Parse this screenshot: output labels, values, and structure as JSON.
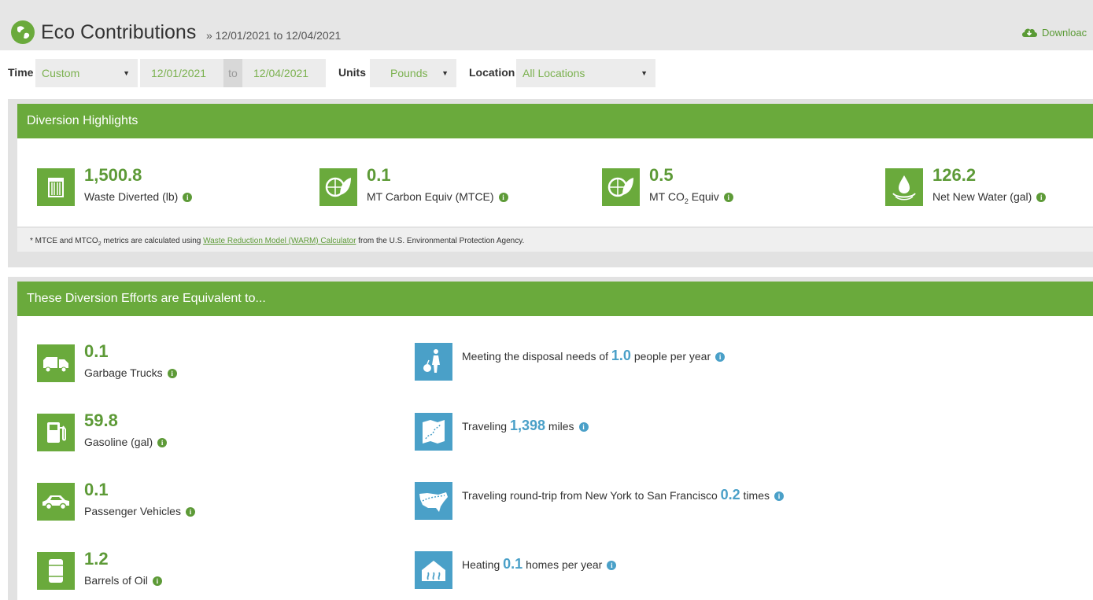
{
  "header": {
    "title": "Eco Contributions",
    "subtitle": "» 12/01/2021 to 12/04/2021",
    "download_label": "Downloac"
  },
  "filters": {
    "time_label": "Time",
    "time_value": "Custom",
    "start_date": "12/01/2021",
    "to_label": "to",
    "end_date": "12/04/2021",
    "units_label": "Units",
    "units_value": "Pounds",
    "location_label": "Location",
    "location_value": "All Locations"
  },
  "highlights": {
    "heading": "Diversion Highlights",
    "metrics": [
      {
        "value": "1,500.8",
        "label": "Waste Diverted (lb)",
        "icon": "trash-can-icon"
      },
      {
        "value": "0.1",
        "label": "MT Carbon Equiv (MTCE)",
        "icon": "leaf-globe-icon"
      },
      {
        "value": "0.5",
        "label_pre": "MT CO",
        "label_sub": "2",
        "label_post": " Equiv",
        "icon": "leaf-globe-icon"
      },
      {
        "value": "126.2",
        "label": "Net New Water (gal)",
        "icon": "water-drop-icon"
      }
    ],
    "footnote_pre": "* MTCE and MTCO",
    "footnote_sub": "2",
    "footnote_mid": " metrics are calculated using ",
    "footnote_link": "Waste Reduction Model (WARM) Calculator",
    "footnote_post": " from the U.S. Environmental Protection Agency."
  },
  "equivalents": {
    "heading": "These Diversion Efforts are Equivalent to...",
    "left": [
      {
        "value": "0.1",
        "label": "Garbage Trucks",
        "icon": "garbage-truck-icon"
      },
      {
        "value": "59.8",
        "label": "Gasoline (gal)",
        "icon": "gas-pump-icon"
      },
      {
        "value": "0.1",
        "label": "Passenger Vehicles",
        "icon": "car-icon"
      },
      {
        "value": "1.2",
        "label": "Barrels of Oil",
        "icon": "oil-barrel-icon"
      }
    ],
    "right": [
      {
        "pre": "Meeting the disposal needs of ",
        "value": "1.0",
        "post": " people per year",
        "icon": "person-trash-icon"
      },
      {
        "pre": "Traveling ",
        "value": "1,398",
        "post": " miles",
        "icon": "route-map-icon"
      },
      {
        "pre": "Traveling round-trip from New York to San Francisco ",
        "value": "0.2",
        "post": " times",
        "icon": "us-map-icon"
      },
      {
        "pre": "Heating ",
        "value": "0.1",
        "post": " homes per year",
        "icon": "home-heat-icon"
      }
    ]
  },
  "info_glyph": "i",
  "colors": {
    "green": "#6aaa3c",
    "blue": "#4aa0c8"
  }
}
